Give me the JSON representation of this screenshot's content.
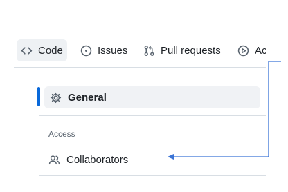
{
  "tabs": [
    {
      "label": "Code",
      "icon": "code-icon",
      "active": true
    },
    {
      "label": "Issues",
      "icon": "issue-opened-icon"
    },
    {
      "label": "Pull requests",
      "icon": "git-pull-request-icon"
    },
    {
      "label": "Ac",
      "icon": "play-icon"
    }
  ],
  "sidebar": {
    "general_label": "General",
    "access_section": "Access",
    "collaborators_label": "Collaborators"
  },
  "colors": {
    "accent": "#0969da",
    "annotation_arrow": "#3b74d6"
  }
}
